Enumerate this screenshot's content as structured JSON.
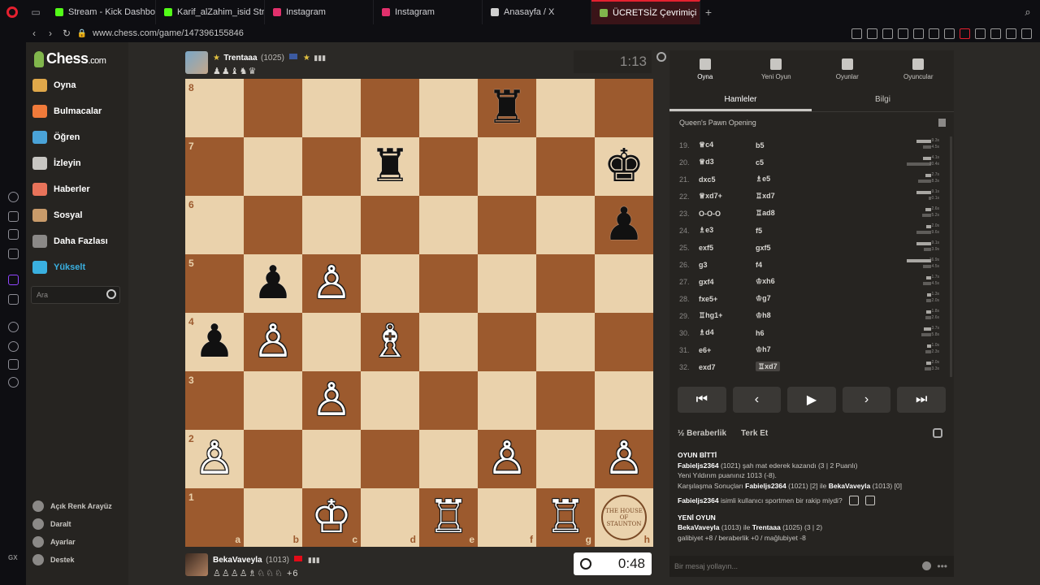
{
  "browser": {
    "tabs": [
      {
        "label": "Stream - Kick Dashboard",
        "favicon_color": "#53fc18"
      },
      {
        "label": "Karif_alZahim_isid Stream",
        "favicon_color": "#53fc18"
      },
      {
        "label": "Instagram",
        "favicon_color": "#e1306c"
      },
      {
        "label": "Instagram",
        "favicon_color": "#e1306c"
      },
      {
        "label": "Anasayfa / X",
        "favicon_color": "#d0d0d0"
      },
      {
        "label": "ÜCRETSİZ Çevrimiçi S...",
        "favicon_color": "#81b64c"
      }
    ],
    "url": "www.chess.com/game/147396155846"
  },
  "sidebar": {
    "logo": "Chess",
    "logo_suffix": ".com",
    "items": [
      {
        "label": "Oyna",
        "color": "#e0a84a"
      },
      {
        "label": "Bulmacalar",
        "color": "#f07a3a"
      },
      {
        "label": "Öğren",
        "color": "#4aa3d8"
      },
      {
        "label": "İzleyin",
        "color": "#c8c6c2"
      },
      {
        "label": "Haberler",
        "color": "#e8735a"
      },
      {
        "label": "Sosyal",
        "color": "#c99b6a"
      },
      {
        "label": "Daha Fazlası",
        "color": "#8b8987"
      },
      {
        "label": "Yükselt",
        "color": "#3ab0e0"
      }
    ],
    "search_placeholder": "Ara",
    "bottom": [
      "Açık Renk Arayüz",
      "Daralt",
      "Ayarlar",
      "Destek"
    ]
  },
  "top_player": {
    "name": "Trentaaa",
    "rating": "(1025)",
    "captured": "♟♟♝♞♛",
    "clock": "1:13"
  },
  "bottom_player": {
    "name": "BekaVaveyla",
    "rating": "(1013)",
    "captured": "♙♙♙♙♗♘♘♘",
    "advantage": "+6",
    "clock": "0:48"
  },
  "board": {
    "ranks": [
      "8",
      "7",
      "6",
      "5",
      "4",
      "3",
      "2",
      "1"
    ],
    "files": [
      "a",
      "b",
      "c",
      "d",
      "e",
      "f",
      "g",
      "h"
    ],
    "pieces": {
      "f8": "♜b",
      "d7": "♜b",
      "h7": "♚b",
      "h6": "♟b",
      "b5": "♟b",
      "c5": "♙w",
      "a4": "♟b",
      "b4": "♙w",
      "d4": "♗w",
      "c3": "♙w",
      "a2": "♙w",
      "f2": "♙w",
      "h2": "♙w",
      "c1": "♔w",
      "e1": "♖w",
      "g1": "♖w"
    },
    "seal_text": "THE HOUSE OF STAUNTON"
  },
  "panel": {
    "tabs": [
      "Oyna",
      "Yeni Oyun",
      "Oyunlar",
      "Oyuncular"
    ],
    "subtabs": [
      "Hamleler",
      "Bilgi"
    ],
    "opening": "Queen's Pawn Opening",
    "moves": [
      {
        "n": "19.",
        "w": "♕c4",
        "b": "b5",
        "wt": "9.3s",
        "bt": "4.5s"
      },
      {
        "n": "20.",
        "w": "♕d3",
        "b": "c5",
        "wt": "4.1s",
        "bt": "20.4s"
      },
      {
        "n": "21.",
        "w": "dxc5",
        "b": "♗e5",
        "wt": "2.7s",
        "bt": "8.3s"
      },
      {
        "n": "22.",
        "w": "♕xd7+",
        "b": "♖xd7",
        "wt": "9.1s",
        "bt": "0.1s"
      },
      {
        "n": "23.",
        "w": "O-O-O",
        "b": "♖ad8",
        "wt": "2.6s",
        "bt": "5.2s"
      },
      {
        "n": "24.",
        "w": "♗e3",
        "b": "f5",
        "wt": "2.0s",
        "bt": "9.6s"
      },
      {
        "n": "25.",
        "w": "exf5",
        "b": "gxf5",
        "wt": "9.1s",
        "bt": "3.9s"
      },
      {
        "n": "26.",
        "w": "g3",
        "b": "f4",
        "wt": "16.9s",
        "bt": "4.5s"
      },
      {
        "n": "27.",
        "w": "gxf4",
        "b": "♔xh6",
        "wt": "1.7s",
        "bt": "4.5s"
      },
      {
        "n": "28.",
        "w": "fxe5+",
        "b": "♔g7",
        "wt": "1.3s",
        "bt": "2.0s"
      },
      {
        "n": "29.",
        "w": "♖hg1+",
        "b": "♔h8",
        "wt": "1.8s",
        "bt": "2.6s"
      },
      {
        "n": "30.",
        "w": "♗d4",
        "b": "h6",
        "wt": "3.7s",
        "bt": "5.8s"
      },
      {
        "n": "31.",
        "w": "e6+",
        "b": "♔h7",
        "wt": "1.0s",
        "bt": "2.3s"
      },
      {
        "n": "32.",
        "w": "exd7",
        "b": "♖xd7",
        "wt": "2.0s",
        "bt": "3.3s"
      }
    ],
    "actions": [
      "½ Beraberlik",
      "Terk Et"
    ],
    "chat": {
      "game_over": "OYUN BİTTİ",
      "line1_name": "Fabieljs2364",
      "line1_rest": "(1021) şah mat ederek kazandı (3 | 2 Puanlı)",
      "line2": "Yeni Yıldırım puanınız 1013 (-8).",
      "line3_pre": "Karşılaşma Sonuçları",
      "line3_name": "Fabieljs2364",
      "line3_mid": "(1021) [2] ile",
      "line3_name2": "BekaVaveyla",
      "line3_end": "(1013) [0]",
      "q_name": "Fabieljs2364",
      "q_rest": "isimli kullanıcı sportmen bir rakip miydi?",
      "new_game": "YENİ OYUN",
      "ng_p1": "BekaVaveyla",
      "ng_mid": "(1013) ile",
      "ng_p2": "Trentaaa",
      "ng_end": "(1025) (3 | 2)",
      "ng_stats": "galibiyet +8 / beraberlik +0 / mağlubiyet -8"
    },
    "message_placeholder": "Bir mesaj yollayın..."
  }
}
